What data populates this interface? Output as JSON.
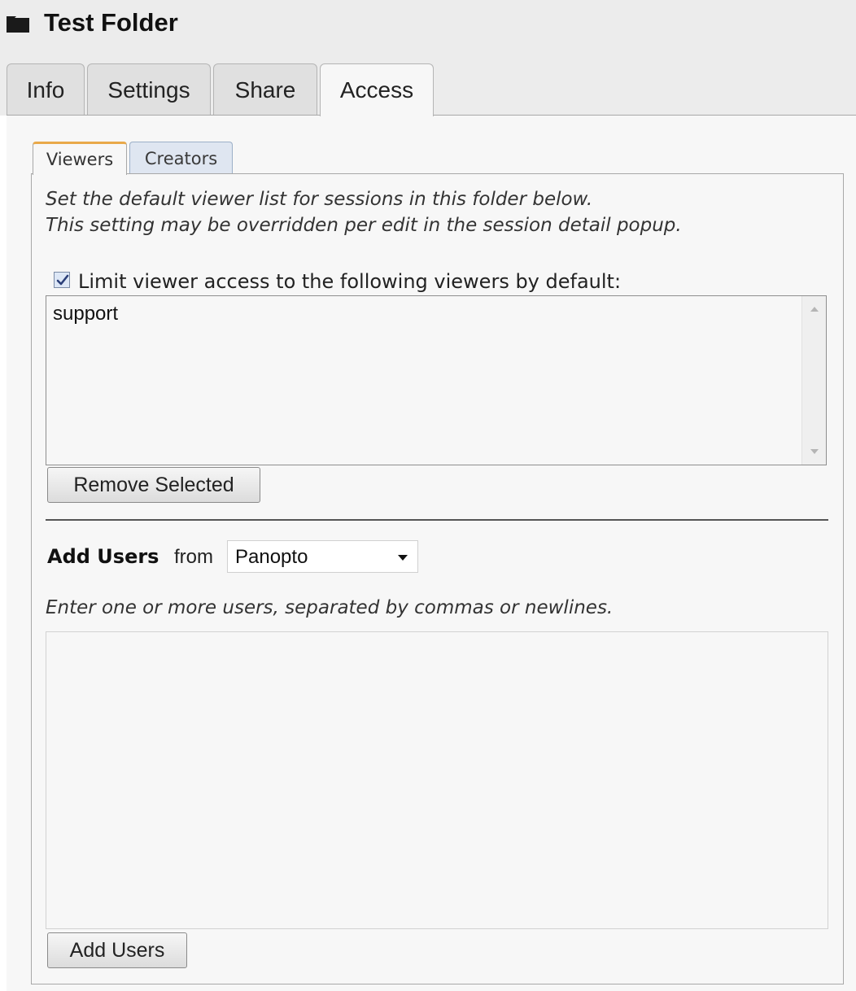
{
  "folder": {
    "title": "Test Folder",
    "icon": "folder-icon"
  },
  "main_tabs": [
    {
      "label": "Info"
    },
    {
      "label": "Settings"
    },
    {
      "label": "Share"
    },
    {
      "label": "Access",
      "active": true
    }
  ],
  "sub_tabs": [
    {
      "label": "Viewers",
      "active": true
    },
    {
      "label": "Creators"
    }
  ],
  "viewers": {
    "description_line1": "Set the default viewer list for sessions in this folder below.",
    "description_line2": "This setting may be overridden per edit in the session detail popup.",
    "limit_checkbox_label": "Limit viewer access to the following viewers by default:",
    "limit_checked": true,
    "list_items": [
      "support"
    ],
    "remove_button": "Remove Selected"
  },
  "add_users": {
    "label_bold": "Add Users",
    "label_from": "from",
    "provider_selected": "Panopto",
    "instructions": "Enter one or more users, separated by commas or newlines.",
    "textarea_value": "",
    "add_button": "Add Users"
  },
  "colors": {
    "active_tab_accent": "#e9a94a",
    "inactive_subtab_bg": "#dfe6f1",
    "panel_bg": "#f7f7f7",
    "header_bg": "#ececec"
  }
}
